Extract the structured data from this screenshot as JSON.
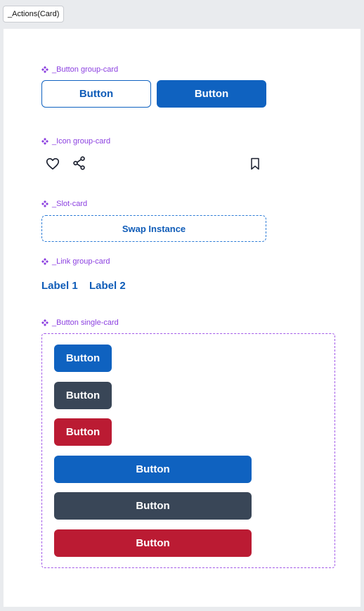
{
  "frame_tab": "_Actions(Card)",
  "sections": {
    "button_group": {
      "label": "_Button group-card",
      "outline_button": "Button",
      "primary_button": "Button"
    },
    "icon_group": {
      "label": "_Icon group-card",
      "icons": [
        "heart-icon",
        "share-icon",
        "bookmark-icon"
      ]
    },
    "slot": {
      "label": "_Slot-card",
      "text": "Swap Instance"
    },
    "link_group": {
      "label": "_Link group-card",
      "link1": "Label 1",
      "link2": "Label 2"
    },
    "button_single": {
      "label": "_Button single-card",
      "buttons": [
        "Button",
        "Button",
        "Button",
        "Button",
        "Button",
        "Button"
      ]
    }
  },
  "colors": {
    "component_label": "#8b3fe0",
    "primary": "#0f62c0",
    "secondary": "#394657",
    "danger": "#bb1b33"
  }
}
